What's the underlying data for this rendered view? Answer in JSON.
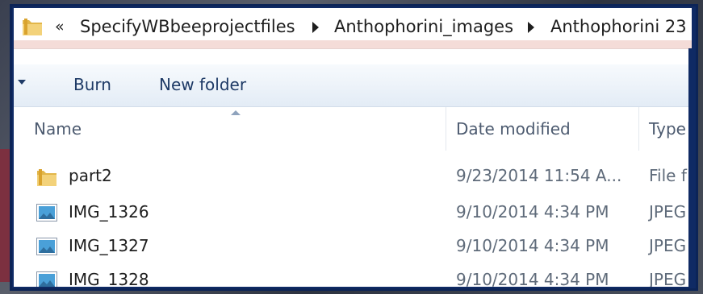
{
  "addressbar": {
    "overflow_glyph": "«",
    "crumbs": [
      "SpecifyWBbeeprojectfiles",
      "Anthophorini_images",
      "Anthophorini 23"
    ]
  },
  "toolbar": {
    "burn_label": "Burn",
    "new_folder_label": "New folder"
  },
  "columns": {
    "name": "Name",
    "date_modified": "Date modified",
    "type": "Type"
  },
  "files": [
    {
      "name": "part2",
      "date": "9/23/2014 11:54 A...",
      "type": "File f",
      "icon": "folder-icon"
    },
    {
      "name": "IMG_1326",
      "date": "9/10/2014 4:34 PM",
      "type": "JPEG",
      "icon": "image-icon"
    },
    {
      "name": "IMG_1327",
      "date": "9/10/2014 4:34 PM",
      "type": "JPEG",
      "icon": "image-icon"
    },
    {
      "name": "IMG_1328",
      "date": "9/10/2014 4:34 PM",
      "type": "JPEG",
      "icon": "image-icon"
    }
  ],
  "colors": {
    "frame": "#0f2a64",
    "toolbar_text": "#1e3a66",
    "header_text": "#4d5b70",
    "date_text": "#5f6b7a"
  }
}
